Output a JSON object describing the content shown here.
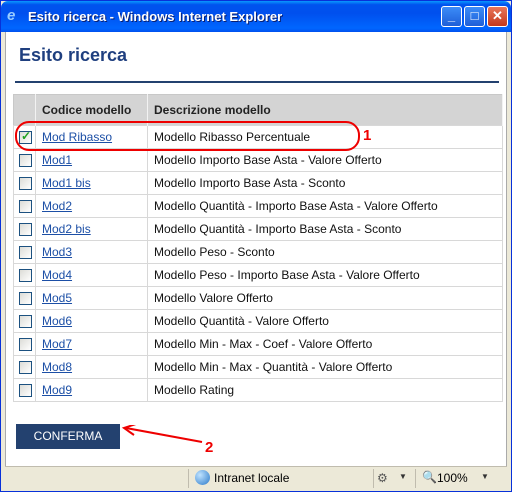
{
  "window": {
    "title": "Esito ricerca - Windows Internet Explorer",
    "minimize": "_",
    "maximize": "□",
    "close": "✕"
  },
  "page": {
    "title": "Esito ricerca"
  },
  "table": {
    "headers": [
      "Codice modello",
      "Descrizione modello"
    ],
    "rows": [
      {
        "code": "Mod Ribasso",
        "description": "Modello Ribasso Percentuale",
        "checked": true
      },
      {
        "code": "Mod1",
        "description": "Modello Importo Base Asta - Valore Offerto",
        "checked": false
      },
      {
        "code": "Mod1 bis",
        "description": "Modello Importo Base Asta - Sconto",
        "checked": false
      },
      {
        "code": "Mod2",
        "description": "Modello Quantità - Importo Base Asta - Valore Offerto",
        "checked": false
      },
      {
        "code": "Mod2 bis",
        "description": "Modello Quantità - Importo Base Asta - Sconto",
        "checked": false
      },
      {
        "code": "Mod3",
        "description": "Modello Peso - Sconto",
        "checked": false
      },
      {
        "code": "Mod4",
        "description": "Modello Peso - Importo Base Asta - Valore Offerto",
        "checked": false
      },
      {
        "code": "Mod5",
        "description": "Modello Valore Offerto",
        "checked": false
      },
      {
        "code": "Mod6",
        "description": "Modello Quantità - Valore Offerto",
        "checked": false
      },
      {
        "code": "Mod7",
        "description": "Modello Min - Max - Coef - Valore Offerto",
        "checked": false
      },
      {
        "code": "Mod8",
        "description": "Modello Min - Max - Quantità - Valore Offerto",
        "checked": false
      },
      {
        "code": "Mod9",
        "description": "Modello Rating",
        "checked": false
      }
    ]
  },
  "actions": {
    "confirm_label": "CONFERMA"
  },
  "annotations": {
    "marker_1": "1",
    "marker_2": "2",
    "color": "#e00000"
  },
  "statusbar": {
    "zone": "Intranet locale",
    "zoom": "100%"
  },
  "icons": {
    "app": "ie-icon",
    "zone": "globe-icon",
    "protected_mode": "lock-icon",
    "zoom": "zoom-icon"
  },
  "colors": {
    "accent": "#23416f",
    "link": "#1c4fa6"
  }
}
